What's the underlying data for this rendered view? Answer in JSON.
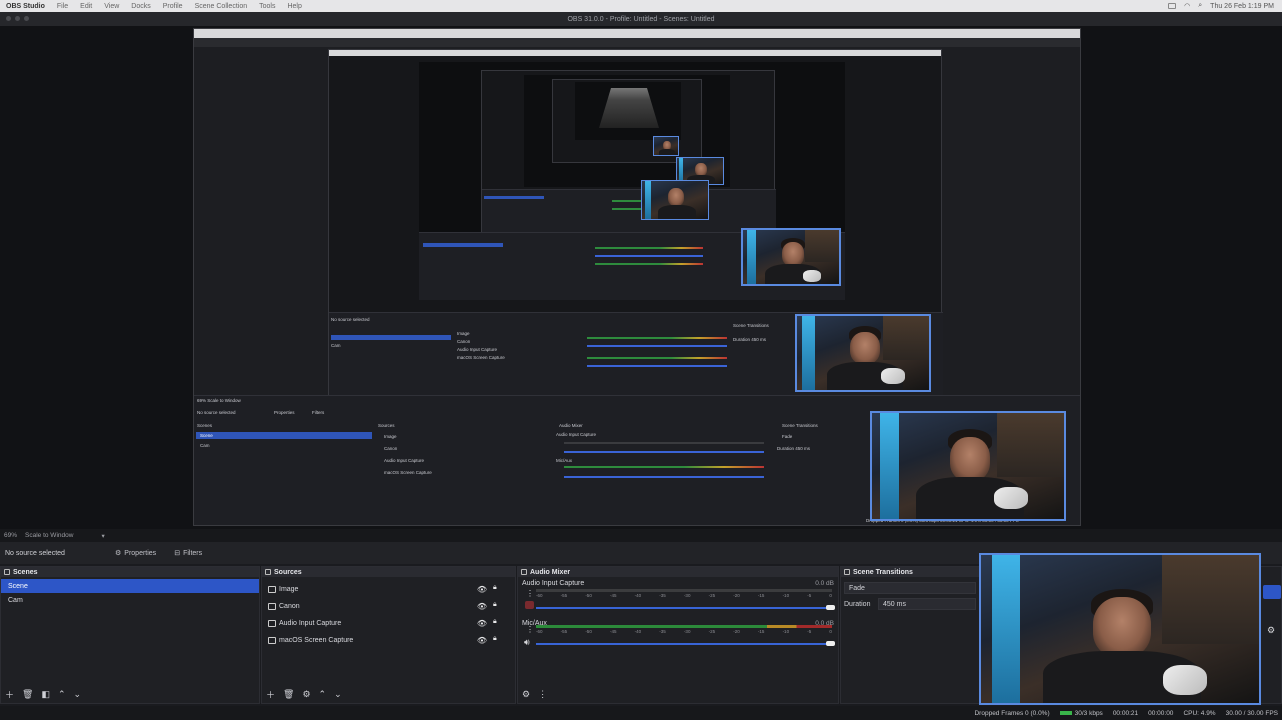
{
  "menubar": {
    "app": "OBS Studio",
    "items": [
      "File",
      "Edit",
      "View",
      "Docks",
      "Profile",
      "Scene Collection",
      "Tools",
      "Help"
    ],
    "clock": "Thu 26 Feb  1:19 PM"
  },
  "window": {
    "title": "OBS 31.0.0 - Profile: Untitled - Scenes: Untitled"
  },
  "scale": {
    "zoom": "69%",
    "mode": "Scale to Window"
  },
  "properties_bar": {
    "no_source": "No source selected",
    "properties_label": "Properties",
    "filters_label": "Filters"
  },
  "scenes": {
    "title": "Scenes",
    "items": [
      "Scene",
      "Cam"
    ]
  },
  "sources": {
    "title": "Sources",
    "items": [
      "Image",
      "Canon",
      "Audio Input Capture",
      "macOS Screen Capture"
    ]
  },
  "mixer": {
    "title": "Audio Mixer",
    "channels": [
      {
        "name": "Audio Input Capture",
        "db": "0.0 dB"
      },
      {
        "name": "Mic/Aux",
        "db": "0.0 dB"
      }
    ],
    "ticks": [
      "-60",
      "-55",
      "-50",
      "-45",
      "-40",
      "-35",
      "-30",
      "-25",
      "-20",
      "-15",
      "-10",
      "-5",
      "0"
    ]
  },
  "transitions": {
    "title": "Scene Transitions",
    "type": "Fade",
    "duration_label": "Duration",
    "duration_value": "450 ms"
  },
  "status": {
    "dropped": "Dropped Frames 0 (0.0%)",
    "bitrate": "30/3 kbps",
    "rec_time": "00:00:21",
    "stream_time": "00:00:00",
    "cpu": "CPU: 4.9%",
    "fps": "30.00 / 30.00 FPS"
  },
  "colors": {
    "accent": "#2d56c7",
    "cam_border": "#5a8ae0"
  }
}
